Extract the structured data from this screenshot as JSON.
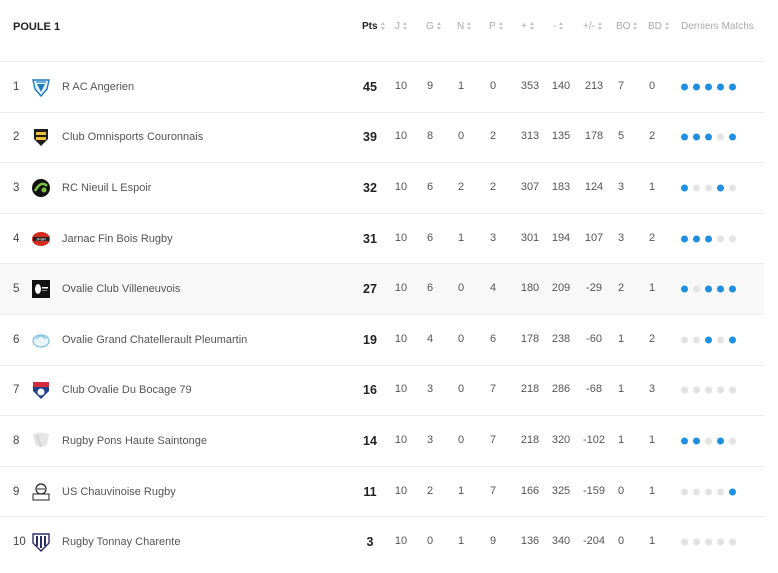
{
  "table": {
    "title": "POULE 1",
    "columns": {
      "pts": "Pts",
      "j": "J",
      "g": "G",
      "n": "N",
      "p": "P",
      "plus": "+",
      "minus": "-",
      "diff": "+/-",
      "bo": "BO",
      "bd": "BD",
      "form": "Derniers Matchs"
    },
    "rows": [
      {
        "rank": "1",
        "team": "R AC Angerien",
        "pts": "45",
        "j": "10",
        "g": "9",
        "n": "1",
        "p": "0",
        "plus": "353",
        "minus": "140",
        "diff": "213",
        "bo": "7",
        "bd": "0",
        "form": [
          "W",
          "W",
          "W",
          "W",
          "W"
        ],
        "logo": "shield-blue"
      },
      {
        "rank": "2",
        "team": "Club Omnisports Couronnais",
        "pts": "39",
        "j": "10",
        "g": "8",
        "n": "0",
        "p": "2",
        "plus": "313",
        "minus": "135",
        "diff": "178",
        "bo": "5",
        "bd": "2",
        "form": [
          "W",
          "W",
          "W",
          "L",
          "W"
        ],
        "logo": "shield-yellow-black"
      },
      {
        "rank": "3",
        "team": "RC Nieuil L Espoir",
        "pts": "32",
        "j": "10",
        "g": "6",
        "n": "2",
        "p": "2",
        "plus": "307",
        "minus": "183",
        "diff": "124",
        "bo": "3",
        "bd": "1",
        "form": [
          "W",
          "L",
          "L",
          "W",
          "L"
        ],
        "logo": "badge-green-black"
      },
      {
        "rank": "4",
        "team": "Jarnac Fin Bois Rugby",
        "pts": "31",
        "j": "10",
        "g": "6",
        "n": "1",
        "p": "3",
        "plus": "301",
        "minus": "194",
        "diff": "107",
        "bo": "3",
        "bd": "2",
        "form": [
          "W",
          "W",
          "W",
          "L",
          "L"
        ],
        "logo": "ball-red"
      },
      {
        "rank": "5",
        "team": "Ovalie Club Villeneuvois",
        "pts": "27",
        "j": "10",
        "g": "6",
        "n": "0",
        "p": "4",
        "plus": "180",
        "minus": "209",
        "diff": "-29",
        "bo": "2",
        "bd": "1",
        "form": [
          "W",
          "L",
          "W",
          "W",
          "W"
        ],
        "logo": "square-black"
      },
      {
        "rank": "6",
        "team": "Ovalie Grand Chatellerault Pleumartin",
        "pts": "19",
        "j": "10",
        "g": "4",
        "n": "0",
        "p": "6",
        "plus": "178",
        "minus": "238",
        "diff": "-60",
        "bo": "1",
        "bd": "2",
        "form": [
          "L",
          "L",
          "W",
          "L",
          "W"
        ],
        "logo": "ball-lightblue"
      },
      {
        "rank": "7",
        "team": "Club Ovalie Du Bocage 79",
        "pts": "16",
        "j": "10",
        "g": "3",
        "n": "0",
        "p": "7",
        "plus": "218",
        "minus": "286",
        "diff": "-68",
        "bo": "1",
        "bd": "3",
        "form": [
          "L",
          "L",
          "L",
          "L",
          "L"
        ],
        "logo": "shield-red-blue"
      },
      {
        "rank": "8",
        "team": "Rugby Pons Haute Saintonge",
        "pts": "14",
        "j": "10",
        "g": "3",
        "n": "0",
        "p": "7",
        "plus": "218",
        "minus": "320",
        "diff": "-102",
        "bo": "1",
        "bd": "1",
        "form": [
          "W",
          "W",
          "L",
          "W",
          "L"
        ],
        "logo": "shield-grey"
      },
      {
        "rank": "9",
        "team": "US Chauvinoise Rugby",
        "pts": "11",
        "j": "10",
        "g": "2",
        "n": "1",
        "p": "7",
        "plus": "166",
        "minus": "325",
        "diff": "-159",
        "bo": "0",
        "bd": "1",
        "form": [
          "L",
          "L",
          "L",
          "L",
          "W"
        ],
        "logo": "crest-black"
      },
      {
        "rank": "10",
        "team": "Rugby Tonnay Charente",
        "pts": "3",
        "j": "10",
        "g": "0",
        "n": "1",
        "p": "9",
        "plus": "136",
        "minus": "340",
        "diff": "-204",
        "bo": "0",
        "bd": "1",
        "form": [
          "L",
          "L",
          "L",
          "L",
          "L"
        ],
        "logo": "shield-navy"
      }
    ]
  },
  "colors": {
    "win": "#1e8fe1",
    "other": "#e3e3e3"
  }
}
